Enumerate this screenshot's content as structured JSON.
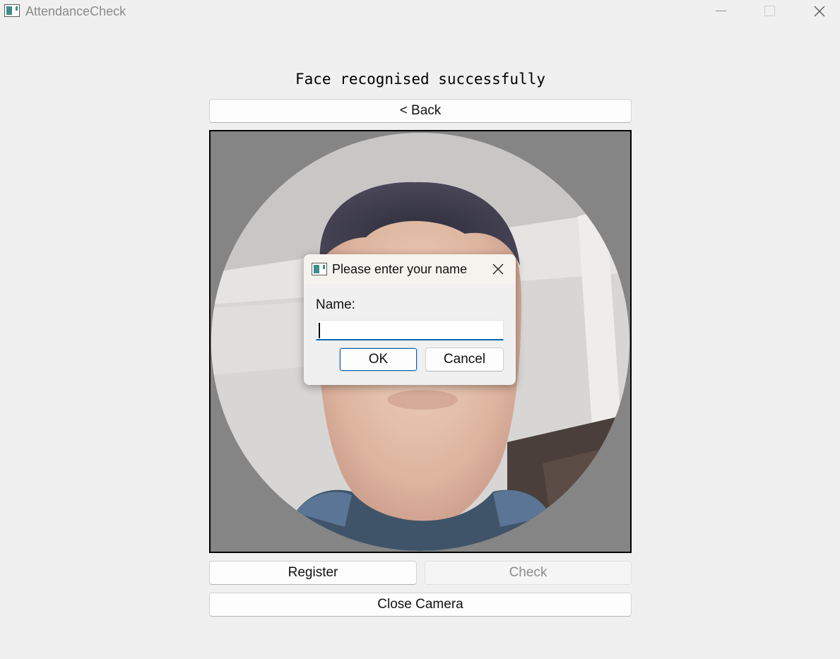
{
  "window": {
    "title": "AttendanceCheck",
    "app_icon": "app-window-icon",
    "controls": [
      "minimize-icon",
      "maximize-icon",
      "close-icon"
    ]
  },
  "main": {
    "status_text": "Face recognised successfully",
    "back_label": "< Back",
    "camera_feed": "webcam-face-view",
    "register_label": "Register",
    "check_label": "Check",
    "check_disabled": true,
    "close_camera_label": "Close Camera"
  },
  "dialog": {
    "title": "Please enter your name",
    "field_label": "Name:",
    "input_value": "",
    "ok_label": "OK",
    "cancel_label": "Cancel"
  },
  "colors": {
    "background": "#f0f0f0",
    "camera_mask": "#858585",
    "focus_accent": "#0067c0"
  }
}
